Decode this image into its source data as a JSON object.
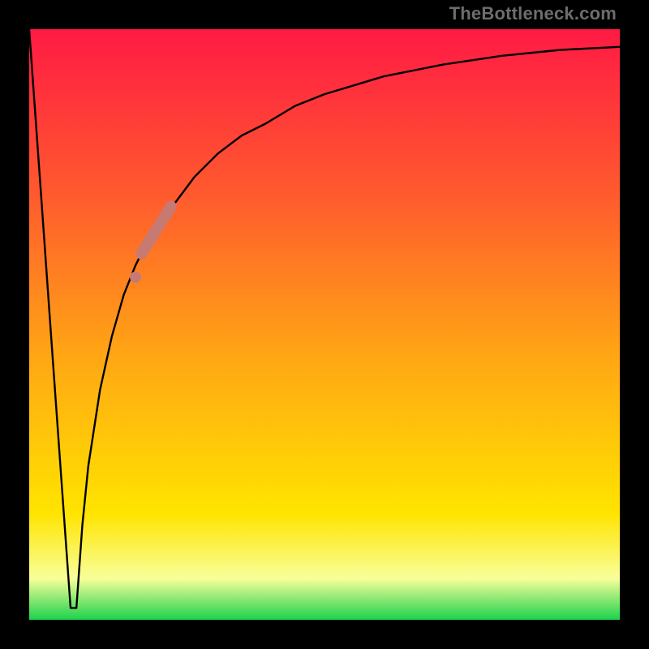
{
  "watermark": "TheBottleneck.com",
  "colors": {
    "top": "#ff1a44",
    "upper": "#ff5a2e",
    "mid": "#ffa514",
    "yellow": "#ffe400",
    "pale": "#f8ff9a",
    "green": "#1cd24c",
    "curve": "#000000",
    "marker": "#c77a72"
  },
  "chart_data": {
    "type": "line",
    "title": "",
    "xlabel": "",
    "ylabel": "",
    "xlim": [
      0,
      100
    ],
    "ylim": [
      0,
      100
    ],
    "series": [
      {
        "name": "bottleneck-curve",
        "note": "V-shaped curve: sharp drop from ~100% to ~2% near x≈7, then asymptotic rise toward ~97%",
        "x": [
          0,
          2,
          4,
          5,
          6,
          7,
          8,
          9,
          10,
          12,
          14,
          16,
          18,
          20,
          22,
          25,
          28,
          32,
          36,
          40,
          45,
          50,
          55,
          60,
          70,
          80,
          90,
          100
        ],
        "y": [
          100,
          72,
          44,
          30,
          16,
          2,
          2,
          16,
          26,
          39,
          48,
          55,
          60,
          64,
          67,
          71,
          75,
          79,
          82,
          84,
          87,
          89,
          90.5,
          92,
          94,
          95.5,
          96.5,
          97
        ]
      }
    ],
    "markers": [
      {
        "name": "highlight-segment-upper",
        "shape": "thick-line",
        "x_range": [
          19,
          24
        ],
        "y_range": [
          62,
          70
        ]
      },
      {
        "name": "highlight-dot-lower",
        "shape": "dot",
        "x": 18,
        "y": 58
      }
    ],
    "background_gradient": {
      "orientation": "vertical",
      "stops": [
        {
          "pos": 0.0,
          "meaning": "high-bottleneck",
          "color_key": "top"
        },
        {
          "pos": 0.28,
          "color_key": "upper"
        },
        {
          "pos": 0.55,
          "color_key": "mid"
        },
        {
          "pos": 0.82,
          "color_key": "yellow"
        },
        {
          "pos": 0.93,
          "color_key": "pale"
        },
        {
          "pos": 1.0,
          "meaning": "no-bottleneck",
          "color_key": "green"
        }
      ]
    }
  }
}
